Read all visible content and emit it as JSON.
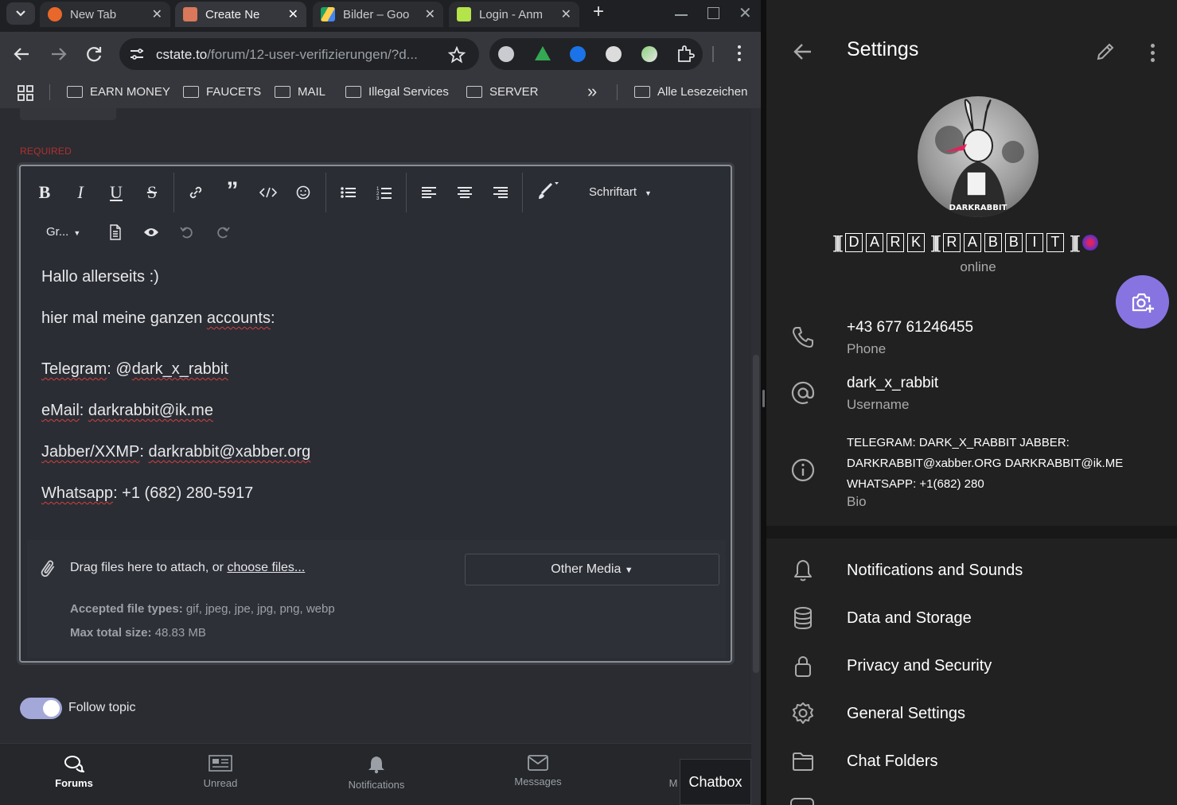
{
  "browser": {
    "tabs": [
      {
        "title": "New Tab",
        "active": false
      },
      {
        "title": "Create Ne",
        "active": true
      },
      {
        "title": "Bilder – Goo",
        "active": false
      },
      {
        "title": "Login - Anm",
        "active": false
      }
    ],
    "url_main": "cstate.to",
    "url_path": "/forum/12-user-verifizierungen/?d...",
    "bookmarks": [
      "EARN MONEY",
      "FAUCETS",
      "MAIL",
      "Illegal Services",
      "SERVER"
    ],
    "bookmarks_more": "»",
    "all_bookmarks": "Alle Lesezeichen"
  },
  "forum": {
    "required_label": "REQUIRED",
    "toolbar": {
      "bold": "B",
      "italic": "I",
      "underline": "U",
      "strike": "S",
      "font_label": "Schriftart",
      "size_label": "Gr..."
    },
    "editor_lines": [
      "Hallo allerseits :)",
      "hier mal meine ganzen accounts:",
      "Telegram: @dark_x_rabbit",
      "eMail: darkrabbit@ik.me",
      "Jabber/XXMP: darkrabbit@xabber.org",
      "Whatsapp: +1 (682) 280-5917"
    ],
    "attach": {
      "prompt": "Drag files here to attach, or",
      "link": "choose files...",
      "other_media": "Other Media",
      "accepted_label": "Accepted file types:",
      "accepted_value": "gif, jpeg, jpe, jpg, png, webp",
      "max_label": "Max total size:",
      "max_value": "48.83 MB"
    },
    "follow_topic": "Follow topic",
    "nav": [
      "Forums",
      "Unread",
      "Notifications",
      "Messages",
      "M"
    ],
    "chatbox": "Chatbox"
  },
  "telegram": {
    "title": "Settings",
    "name_letters_1": [
      "D",
      "A",
      "R",
      "K"
    ],
    "name_letters_2": [
      "R",
      "A",
      "B",
      "B",
      "I",
      "T"
    ],
    "status": "online",
    "avatar_caption": "DARKRABBIT",
    "phone": "+43 677 61246455",
    "phone_label": "Phone",
    "username": "dark_x_rabbit",
    "username_label": "Username",
    "bio_line1": "TELEGRAM: DARK_X_RABBIT JABBER:",
    "bio_line2": "DARKRABBIT@xabber.ORG DARKRABBIT@ik.ME",
    "bio_line3": "WHATSAPP: +1(682) 280",
    "bio_label": "Bio",
    "menu": [
      "Notifications and Sounds",
      "Data and Storage",
      "Privacy and Security",
      "General Settings",
      "Chat Folders"
    ],
    "accent": "#8774e1"
  }
}
